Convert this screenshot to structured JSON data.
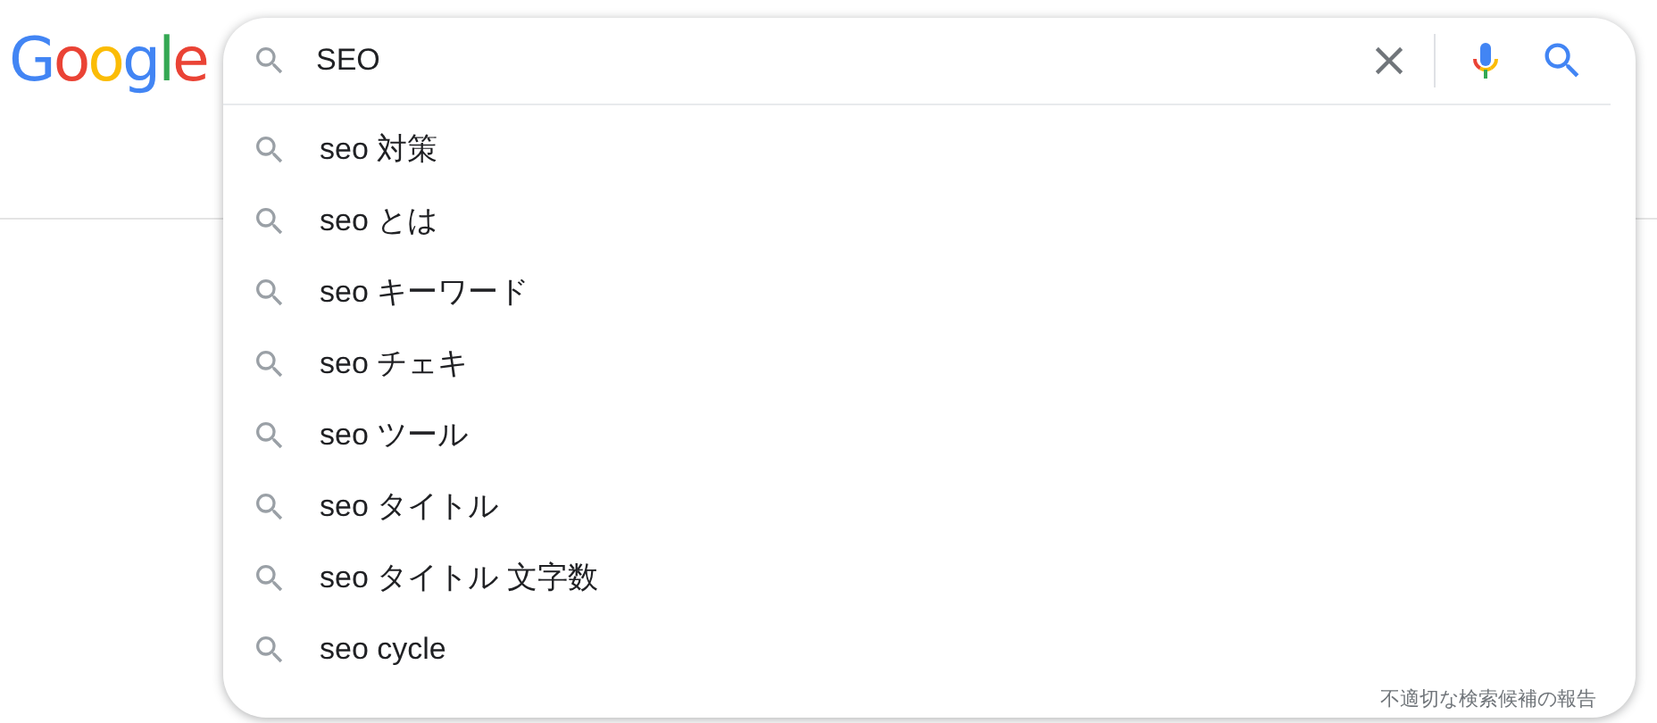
{
  "logo": {
    "text": "Google"
  },
  "search": {
    "value": "SEO"
  },
  "suggestions": [
    {
      "text": "seo 対策"
    },
    {
      "text": "seo とは"
    },
    {
      "text": "seo キーワード"
    },
    {
      "text": "seo チェキ"
    },
    {
      "text": "seo ツール"
    },
    {
      "text": "seo タイトル"
    },
    {
      "text": "seo タイトル 文字数"
    },
    {
      "text": "seo cycle"
    }
  ],
  "report_link": "不適切な検索候補の報告"
}
